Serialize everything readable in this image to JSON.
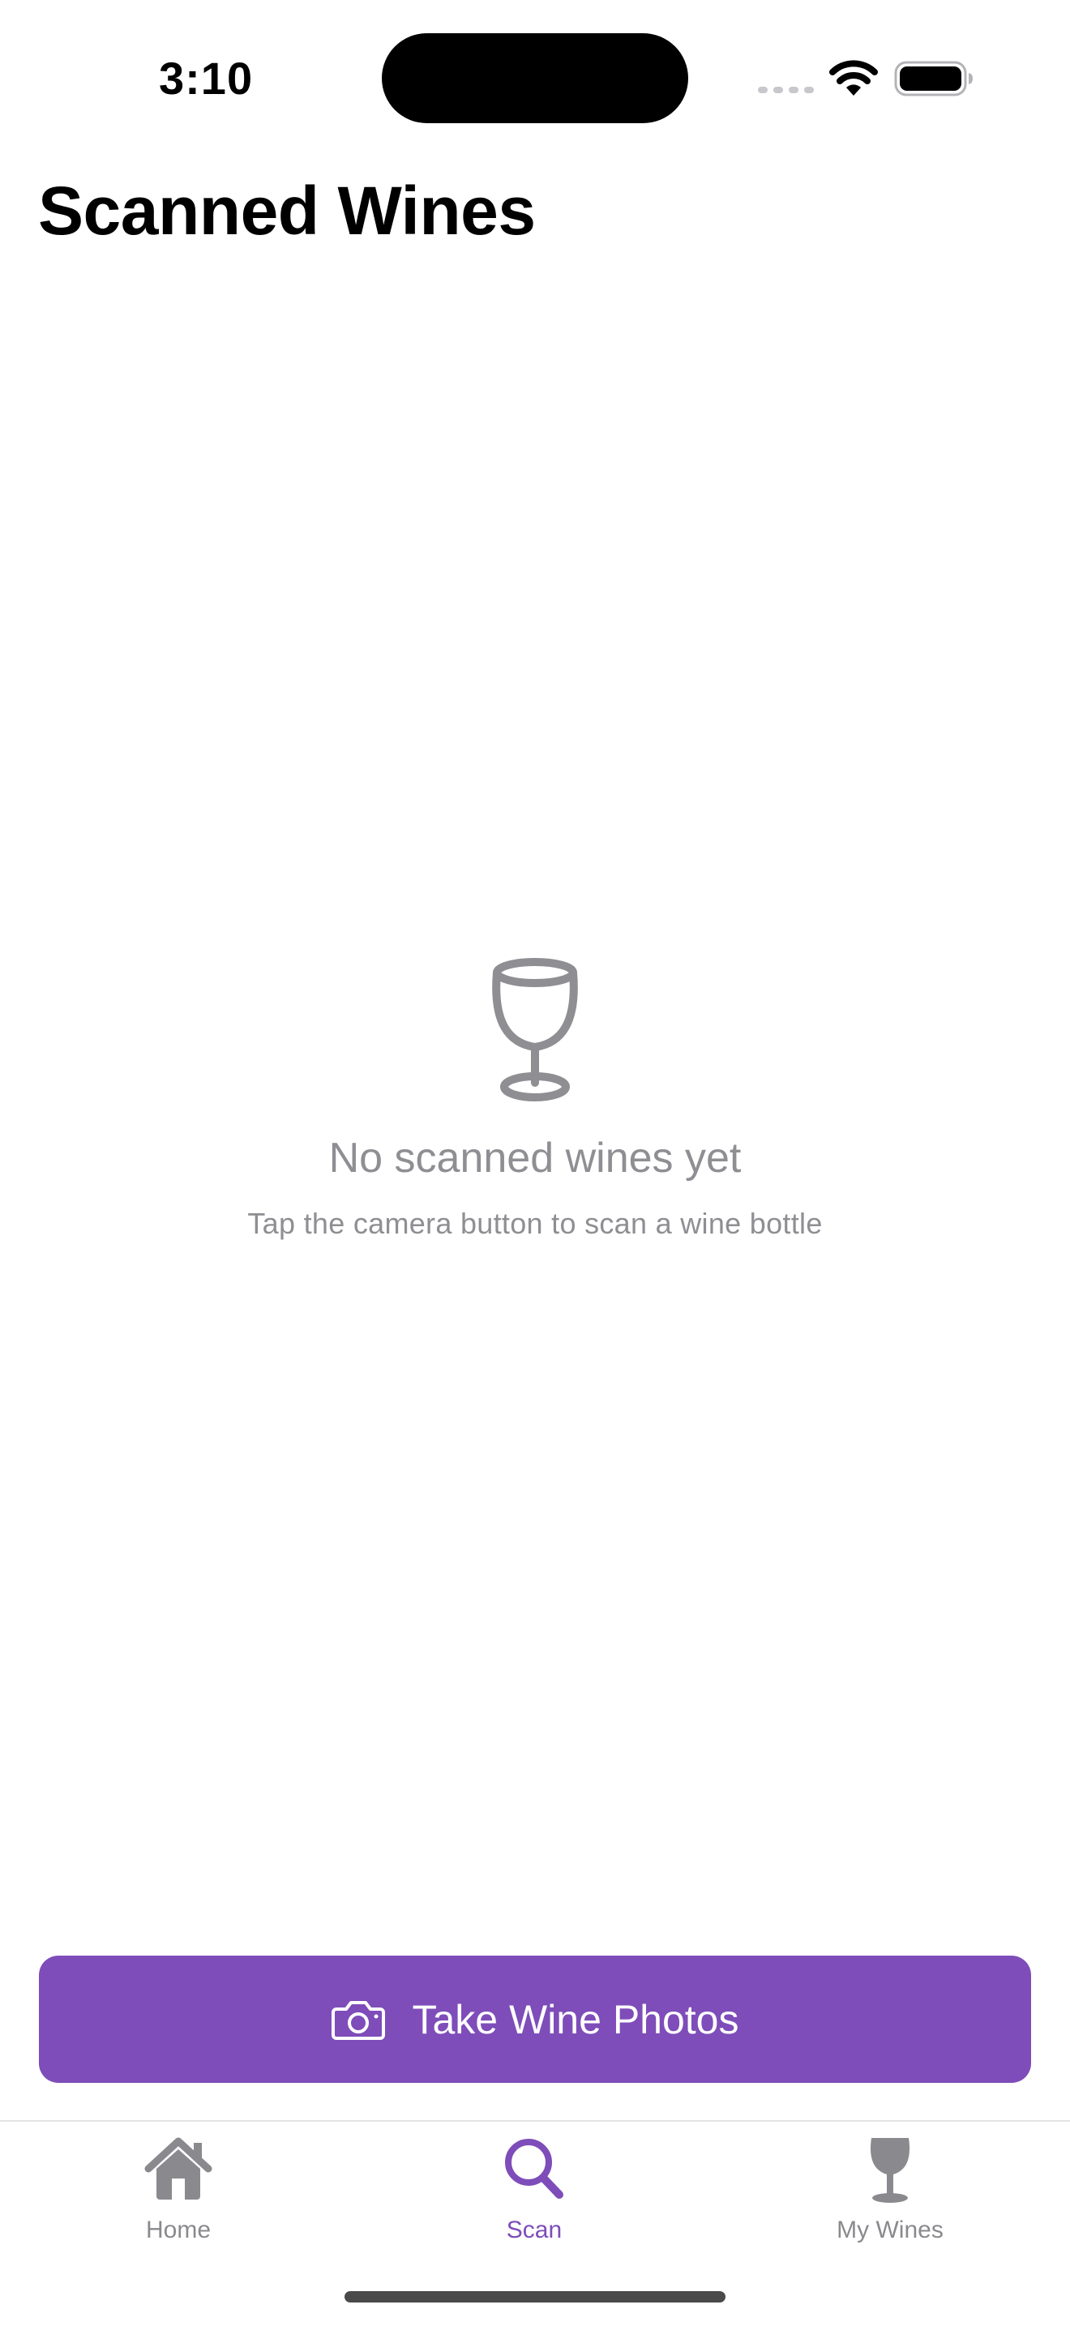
{
  "status_bar": {
    "time": "3:10",
    "icons": [
      "signal-dots-icon",
      "wifi-icon",
      "battery-icon"
    ]
  },
  "header": {
    "title": "Scanned Wines"
  },
  "empty_state": {
    "icon": "wine-glass-icon",
    "title": "No scanned wines yet",
    "subtitle": "Tap the camera button to scan a wine bottle"
  },
  "primary_action": {
    "icon": "camera-icon",
    "label": "Take Wine Photos"
  },
  "tab_bar": {
    "tabs": [
      {
        "label": "Home",
        "icon": "home-icon",
        "active": false
      },
      {
        "label": "Scan",
        "icon": "search-icon",
        "active": true
      },
      {
        "label": "My Wines",
        "icon": "wine-glass-filled-icon",
        "active": false
      }
    ]
  },
  "colors": {
    "accent": "#7e4db9",
    "secondary_text": "#8e8e93",
    "inactive_tab": "#8a8a8e",
    "background": "#ffffff"
  }
}
